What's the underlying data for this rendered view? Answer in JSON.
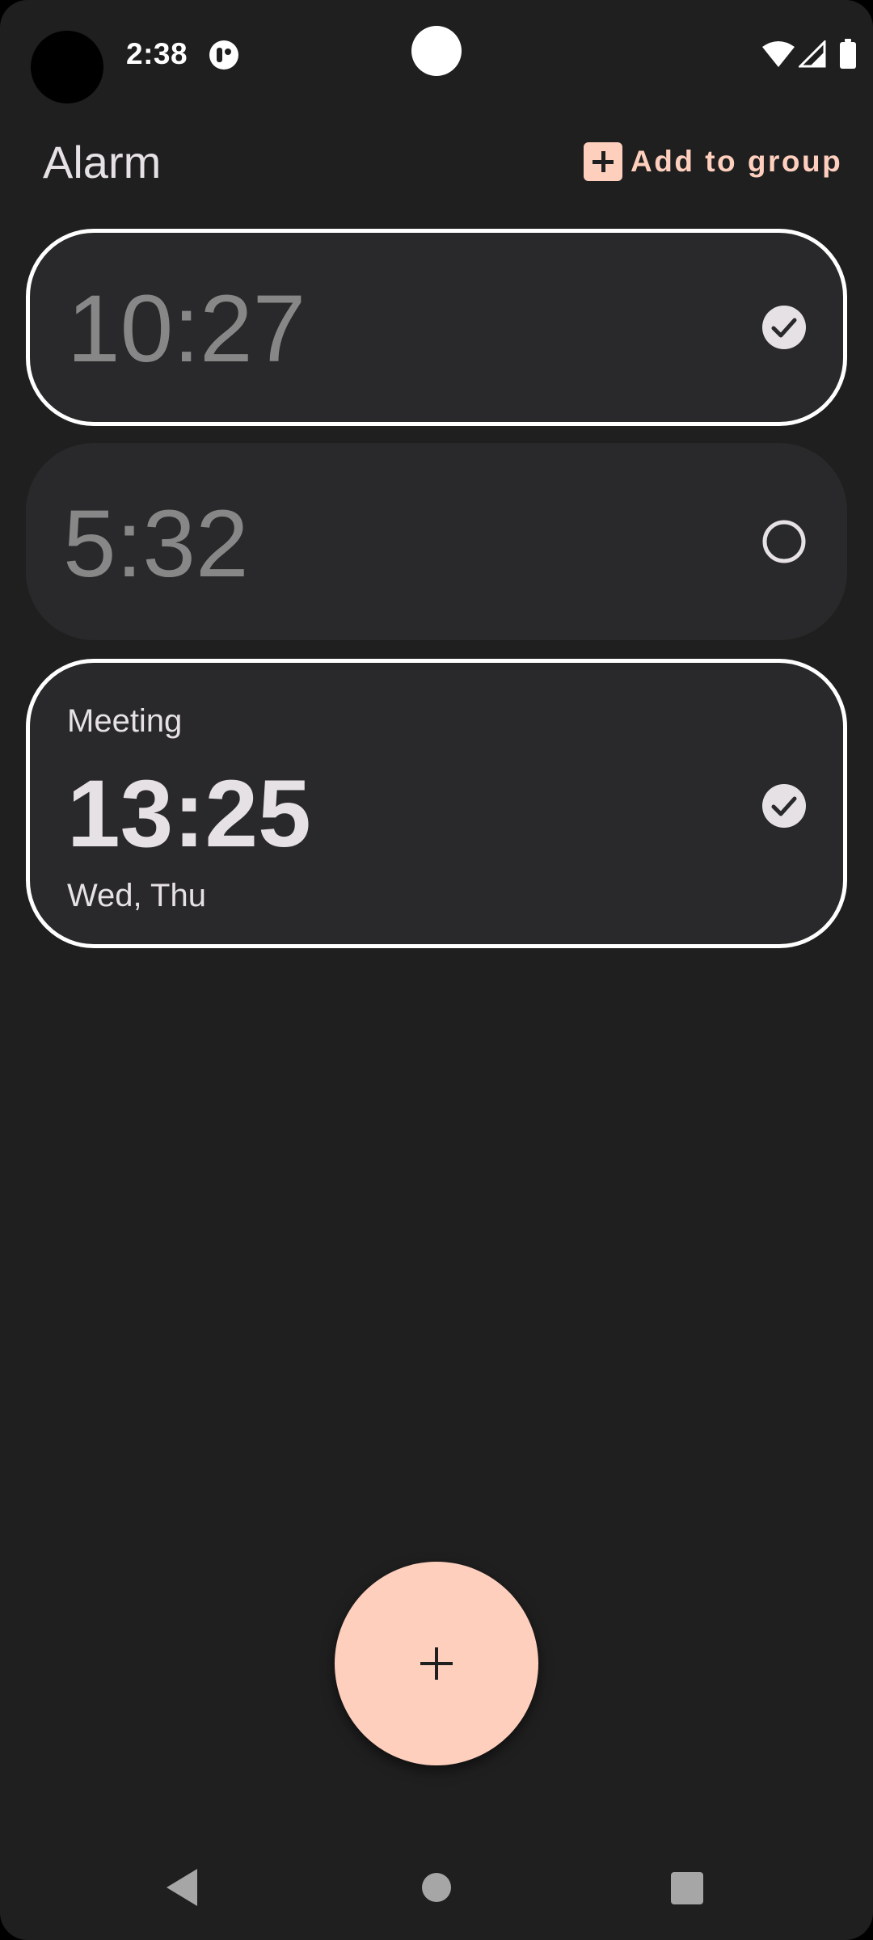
{
  "status_bar": {
    "time": "2:38",
    "icons": [
      "notification-icon",
      "wifi-icon",
      "signal-icon",
      "battery-icon"
    ]
  },
  "header": {
    "title": "Alarm",
    "add_to_group_label": "Add to group",
    "add_to_group_icon": "plus-box-icon"
  },
  "alarms": [
    {
      "time": "10:27",
      "label": "",
      "days": "",
      "selected": true,
      "enabled": false
    },
    {
      "time": "5:32",
      "label": "",
      "days": "",
      "selected": false,
      "enabled": false
    },
    {
      "time": "13:25",
      "label": "Meeting",
      "days": "Wed, Thu",
      "selected": true,
      "enabled": true
    }
  ],
  "fab": {
    "icon": "plus-icon"
  },
  "nav_bar": {
    "icons": [
      "back-icon",
      "home-icon",
      "recents-icon"
    ]
  },
  "colors": {
    "background": "#1f1f1f",
    "card": "#29292b",
    "accent": "#ffcfbe",
    "text_primary": "#e6e1e5",
    "text_disabled": "#878787"
  }
}
